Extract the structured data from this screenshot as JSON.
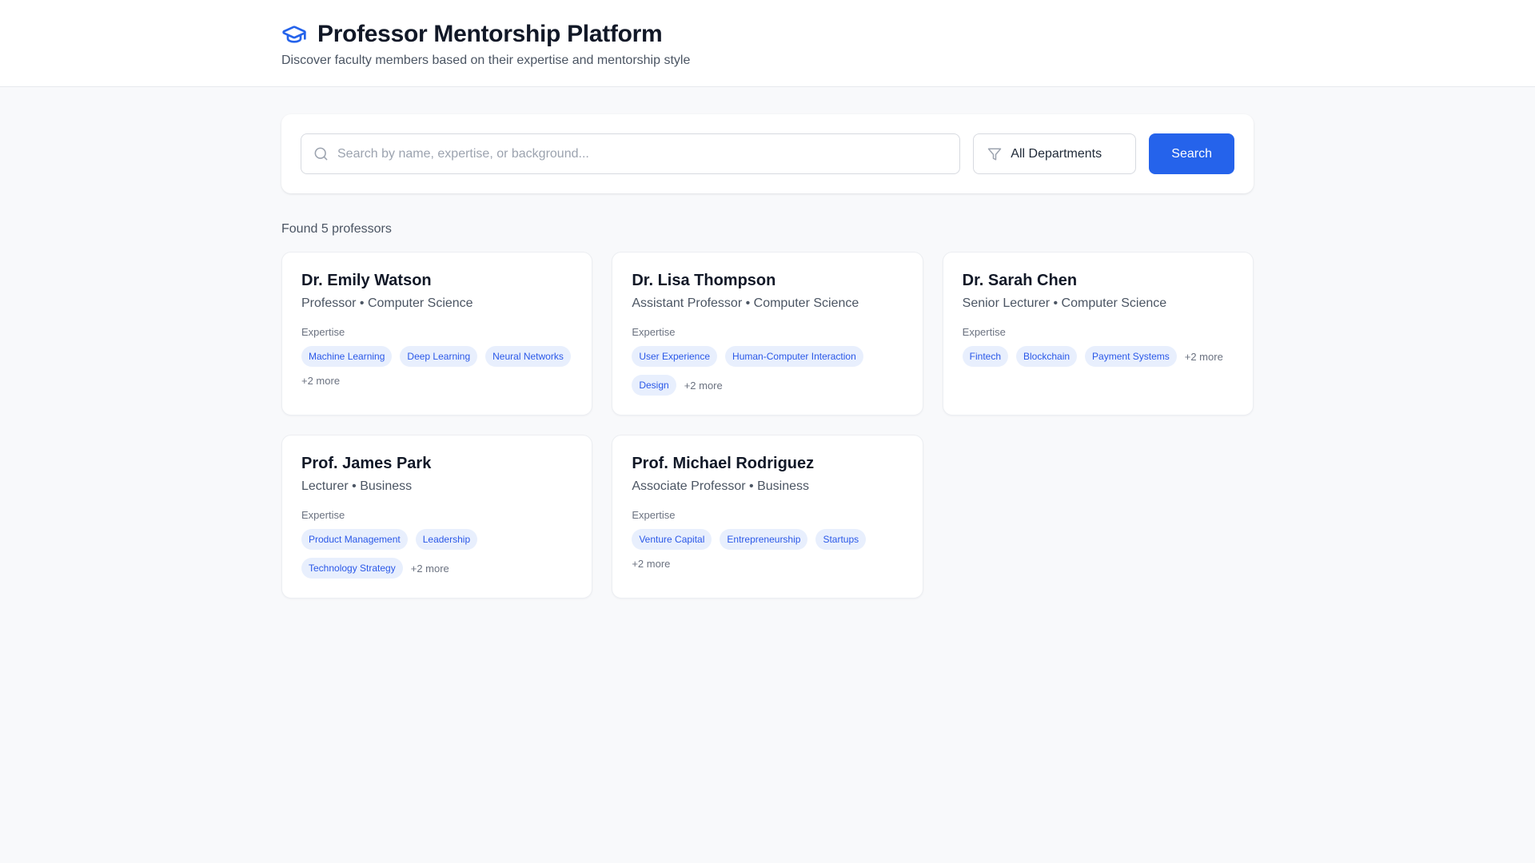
{
  "header": {
    "title": "Professor Mentorship Platform",
    "subtitle": "Discover faculty members based on their expertise and mentorship style"
  },
  "search": {
    "placeholder": "Search by name, expertise, or background...",
    "department_value": "All Departments",
    "button_label": "Search"
  },
  "results": {
    "count_text": "Found 5 professors",
    "expertise_label": "Expertise"
  },
  "professors": [
    {
      "name": "Dr. Emily Watson",
      "title_department": "Professor • Computer Science",
      "tags": [
        "Machine Learning",
        "Deep Learning",
        "Neural Networks"
      ],
      "more": "+2 more"
    },
    {
      "name": "Dr. Lisa Thompson",
      "title_department": "Assistant Professor • Computer Science",
      "tags": [
        "User Experience",
        "Human-Computer Interaction",
        "Design"
      ],
      "more": "+2 more"
    },
    {
      "name": "Dr. Sarah Chen",
      "title_department": "Senior Lecturer • Computer Science",
      "tags": [
        "Fintech",
        "Blockchain",
        "Payment Systems"
      ],
      "more": "+2 more"
    },
    {
      "name": "Prof. James Park",
      "title_department": "Lecturer • Business",
      "tags": [
        "Product Management",
        "Leadership",
        "Technology Strategy"
      ],
      "more": "+2 more"
    },
    {
      "name": "Prof. Michael Rodriguez",
      "title_department": "Associate Professor • Business",
      "tags": [
        "Venture Capital",
        "Entrepreneurship",
        "Startups"
      ],
      "more": "+2 more"
    }
  ],
  "icons": {
    "logo": "graduation-cap-icon",
    "search": "search-icon",
    "filter": "filter-icon"
  },
  "colors": {
    "accent": "#2563eb",
    "page_bg": "#f8f9fb",
    "tag_bg": "#e8effd",
    "tag_text": "#2a58e8"
  }
}
